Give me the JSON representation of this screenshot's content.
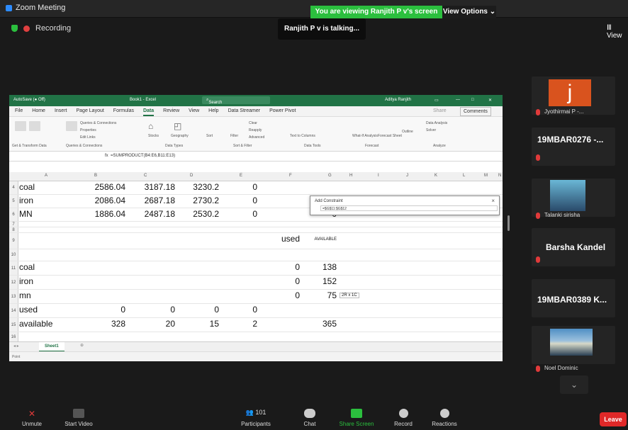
{
  "window": {
    "title": "Zoom Meeting"
  },
  "banner": {
    "viewing": "You are viewing Ranjith P v's screen",
    "view_options": "View Options ⌄",
    "view_top_right": "Ⅲ View"
  },
  "recording": {
    "label": "Recording"
  },
  "speaker": {
    "talking": "Ranjith P v is talking..."
  },
  "excel": {
    "titlebar": {
      "autosave": "AutoSave (● Off)",
      "book": "Book1 - Excel",
      "search": "Search",
      "user": "Aditya Ranjith"
    },
    "menus": [
      "File",
      "Home",
      "Insert",
      "Page Layout",
      "Formulas",
      "Data",
      "Review",
      "View",
      "Help",
      "Data Streamer",
      "Power Pivot"
    ],
    "active_menu": "Data",
    "comments": "Comments",
    "share": "Share",
    "ribbon": {
      "groups": [
        "Get & Transform Data",
        "Queries & Connections",
        "Data Types",
        "Sort & Filter",
        "Data Tools",
        "Forecast",
        "Analyze"
      ],
      "buttons": [
        "Queries & Connections",
        "Properties",
        "Edit Links",
        "Stocks",
        "Geography",
        "Sort",
        "Filter",
        "Clear",
        "Reapply",
        "Advanced",
        "Text to Columns",
        "What-If Analysis",
        "Forecast Sheet",
        "Outline",
        "Data Analysis",
        "Solver"
      ]
    },
    "formula": {
      "namebox": "",
      "fx": "fx",
      "text": "=SUMPRODUCT(B4:E6,B11:E13)"
    },
    "columns": [
      "A",
      "B",
      "C",
      "D",
      "E",
      "F",
      "G",
      "H",
      "I",
      "J",
      "K",
      "L",
      "M",
      "N"
    ],
    "rows": [
      {
        "num": "4",
        "a": "coal",
        "b": "2586.04",
        "c": "3187.18",
        "d": "3230.2",
        "e": "0",
        "f": "",
        "g": ""
      },
      {
        "num": "5",
        "a": "iron",
        "b": "2086.04",
        "c": "2687.18",
        "d": "2730.2",
        "e": "0",
        "f": "",
        "g": ""
      },
      {
        "num": "6",
        "a": "MN",
        "b": "1886.04",
        "c": "2487.18",
        "d": "2530.2",
        "e": "0",
        "f": "",
        "g": "0"
      },
      {
        "num": "7",
        "a": "",
        "b": "",
        "c": "",
        "d": "",
        "e": "",
        "f": "",
        "g": ""
      },
      {
        "num": "8",
        "a": "",
        "b": "",
        "c": "",
        "d": "",
        "e": "",
        "f": "",
        "g": ""
      },
      {
        "num": "9",
        "a": "",
        "b": "",
        "c": "",
        "d": "",
        "e": "",
        "f": "used",
        "g": "AVAILABLE"
      },
      {
        "num": "10",
        "a": "",
        "b": "",
        "c": "",
        "d": "",
        "e": "",
        "f": "",
        "g": ""
      },
      {
        "num": "11",
        "a": "coal",
        "b": "",
        "c": "",
        "d": "",
        "e": "",
        "f": "0",
        "g": "138"
      },
      {
        "num": "12",
        "a": "iron",
        "b": "",
        "c": "",
        "d": "",
        "e": "",
        "f": "0",
        "g": "152"
      },
      {
        "num": "13",
        "a": "mn",
        "b": "",
        "c": "",
        "d": "",
        "e": "",
        "f": "0",
        "g": "75"
      },
      {
        "num": "14",
        "a": "used",
        "b": "0",
        "c": "0",
        "d": "0",
        "e": "0",
        "f": "",
        "g": ""
      },
      {
        "num": "15",
        "a": "available",
        "b": "328",
        "c": "20",
        "d": "15",
        "e": "2",
        "f": "",
        "g": "365"
      },
      {
        "num": "16",
        "a": "",
        "b": "",
        "c": "",
        "d": "",
        "e": "",
        "f": "",
        "g": ""
      }
    ],
    "tooltip": "2R x 1C",
    "add_constraint": {
      "title": "Add Constraint",
      "close": "×",
      "value": "=$G$11:$G$12"
    },
    "sheet": "Sheet1",
    "status": "Point"
  },
  "participants_tiles": [
    {
      "name": "Jyothirmai P -...",
      "type": "avatar",
      "letter": "j"
    },
    {
      "name": "19MBAR0276 -...",
      "type": "text"
    },
    {
      "name": "Talanki sirisha",
      "type": "photo"
    },
    {
      "name": "Barsha Kandel",
      "type": "text"
    },
    {
      "name": "19MBAR0389 K...",
      "type": "text"
    },
    {
      "name": "Noel Dominic",
      "type": "photo"
    }
  ],
  "toolbar": {
    "unmute": "Unmute",
    "start_video": "Start Video",
    "participants": "Participants",
    "participants_count": "101",
    "chat": "Chat",
    "share_screen": "Share Screen",
    "record": "Record",
    "reactions": "Reactions",
    "leave": "Leave"
  },
  "colors": {
    "excel_green": "#217346",
    "zoom_green": "#2bbf3e",
    "leave_red": "#e02828",
    "avatar_orange": "#d9531e"
  }
}
